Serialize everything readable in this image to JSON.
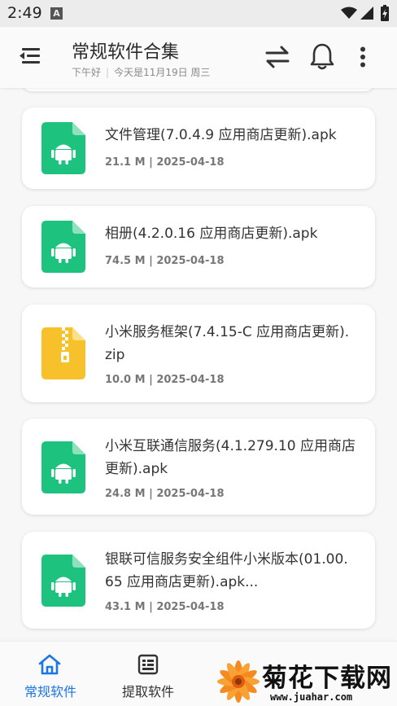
{
  "status_bar": {
    "time": "2:49",
    "notification_letter": "A"
  },
  "header": {
    "title": "常规软件合集",
    "greeting": "下午好",
    "date_text": "今天是11月19日 周三",
    "separator": "|"
  },
  "files": [
    {
      "name": "文件管理(7.0.4.9 应用商店更新).apk",
      "size": "21.1 M",
      "date": "2025-04-18",
      "meta": "21.1 M | 2025-04-18",
      "icon": "android-apk-icon",
      "color": "#1ec27f"
    },
    {
      "name": "相册(4.2.0.16 应用商店更新).apk",
      "size": "74.5 M",
      "date": "2025-04-18",
      "meta": "74.5 M | 2025-04-18",
      "icon": "android-apk-icon",
      "color": "#1ec27f"
    },
    {
      "name": "小米服务框架(7.4.15-C 应用商店更新).zip",
      "size": "10.0 M",
      "date": "2025-04-18",
      "meta": "10.0 M | 2025-04-18",
      "icon": "zip-archive-icon",
      "color": "#f6c12b"
    },
    {
      "name": "小米互联通信服务(4.1.279.10 应用商店更新).apk",
      "size": "24.8 M",
      "date": "2025-04-18",
      "meta": "24.8 M | 2025-04-18",
      "icon": "android-apk-icon",
      "color": "#1ec27f"
    },
    {
      "name": "银联可信服务安全组件小米版本(01.00.65 应用商店更新).apk...",
      "size": "43.1 M",
      "date": "2025-04-18",
      "meta": "43.1 M | 2025-04-18",
      "icon": "android-apk-icon",
      "color": "#1ec27f"
    }
  ],
  "bottom_nav": {
    "items": [
      {
        "label": "常规软件",
        "icon": "home-icon",
        "active": true
      },
      {
        "label": "提取软件",
        "icon": "list-box-icon",
        "active": false
      }
    ]
  },
  "watermark": {
    "text": "菊花下载网",
    "url": "www.juahar.com"
  },
  "colors": {
    "accent": "#1b76e8",
    "apk_green": "#1ec27f",
    "zip_yellow": "#f6c12b"
  }
}
